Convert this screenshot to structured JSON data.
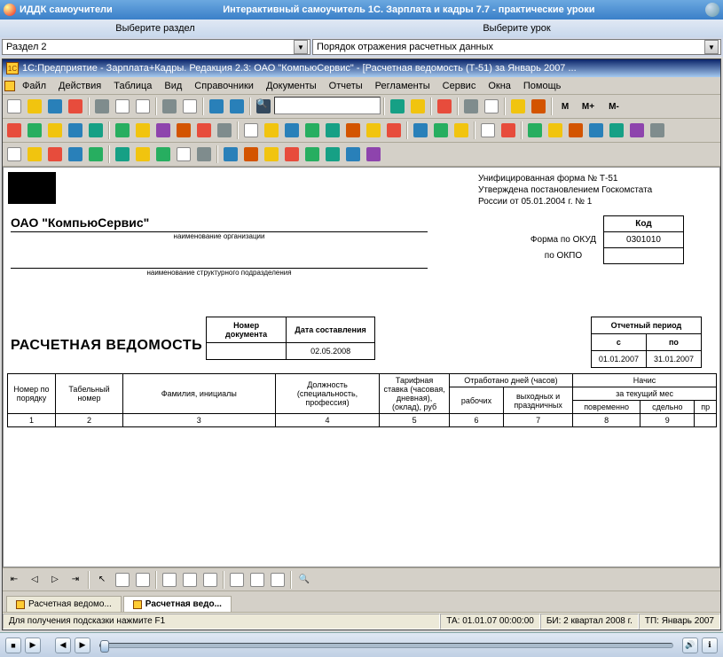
{
  "outer": {
    "app_name": "ИДДК самоучители",
    "main_title": "Интерактивный самоучитель 1С. Зарплата и кадры 7.7 - практические уроки",
    "choose_section": "Выберите раздел",
    "choose_lesson": "Выберите урок",
    "section_value": "Раздел 2",
    "lesson_value": "Порядок отражения  расчетных данных"
  },
  "inner": {
    "title": "1С:Предприятие - Зарплата+Кадры. Редакция 2.3: ОАО \"КомпьюСервис\" - [Расчетная ведомость (Т-51) за Январь 2007 ...",
    "menu": [
      "Файл",
      "Действия",
      "Таблица",
      "Вид",
      "Справочники",
      "Документы",
      "Отчеты",
      "Регламенты",
      "Сервис",
      "Окна",
      "Помощь"
    ]
  },
  "doc": {
    "form_line1": "Унифицированная форма № Т-51",
    "form_line2": "Утверждена постановлением Госкомстата",
    "form_line3": "России от 05.01.2004 г. № 1",
    "org_name": "ОАО \"КомпьюСервис\"",
    "org_caption": "наименование организации",
    "subdiv_caption": "наименование структурного подразделения",
    "kod_header": "Код",
    "okud_label": "Форма по ОКУД",
    "okud_value": "0301010",
    "okpo_label": "по ОКПО",
    "doc_title": "РАСЧЕТНАЯ ВЕДОМОСТЬ",
    "docnum_header": "Номер документа",
    "docdate_header": "Дата составления",
    "docdate_value": "02.05.2008",
    "period_header": "Отчетный период",
    "period_from_h": "с",
    "period_to_h": "по",
    "period_from": "01.01.2007",
    "period_to": "31.01.2007",
    "grid": {
      "h_num": "Номер по порядку",
      "h_tab": "Табельный номер",
      "h_fio": "Фамилия, инициалы",
      "h_job": "Должность (специальность, профессия)",
      "h_rate": "Тарифная ставка (часовая, дневная), (оклад), руб",
      "h_worked": "Отработано дней (часов)",
      "h_work1": "рабочих",
      "h_work2": "выходных и праздничных",
      "h_accr": "Начис",
      "h_curr": "за текущий мес",
      "h_pov": "повременно",
      "h_sdel": "сдельно",
      "h_pr": "пр",
      "nums": [
        "1",
        "2",
        "3",
        "4",
        "5",
        "6",
        "7",
        "8",
        "9"
      ]
    }
  },
  "tabs": {
    "tab1": "Расчетная ведомо...",
    "tab2": "Расчетная ведо..."
  },
  "status": {
    "hint": "Для получения подсказки нажмите F1",
    "ta": "ТА: 01.01.07  00:00:00",
    "bi": "БИ: 2 квартал 2008 г.",
    "tp": "ТП: Январь 2007"
  },
  "toolbar_text": {
    "m": "M",
    "mplus": "M+",
    "mminus": "M-"
  }
}
